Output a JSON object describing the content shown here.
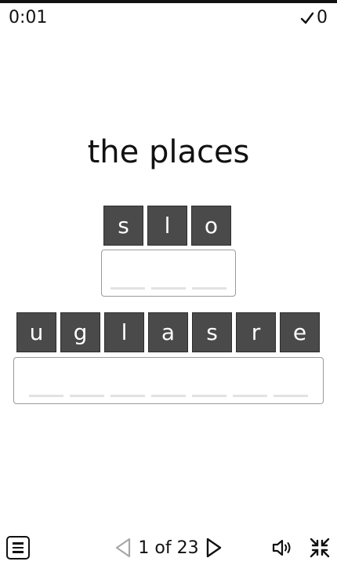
{
  "header": {
    "timer": "0:01",
    "score": "0",
    "icons": {
      "score": "check-icon"
    }
  },
  "prompt": "the places",
  "puzzles": [
    {
      "tiles": [
        "s",
        "l",
        "o"
      ],
      "blank_count": 3
    },
    {
      "tiles": [
        "u",
        "g",
        "l",
        "a",
        "s",
        "r",
        "e"
      ],
      "blank_count": 7
    }
  ],
  "footer": {
    "page_indicator": "1 of 23",
    "icons": {
      "menu": "menu-icon",
      "prev": "prev-arrow-icon",
      "next": "next-arrow-icon",
      "sound": "speaker-icon",
      "collapse": "collapse-icon"
    }
  },
  "colors": {
    "tile_bg": "#4a4a4a",
    "text": "#111111",
    "blank": "#e2e2e2",
    "box_border": "#9a9a9a",
    "disabled_arrow": "#a8a8a8"
  }
}
